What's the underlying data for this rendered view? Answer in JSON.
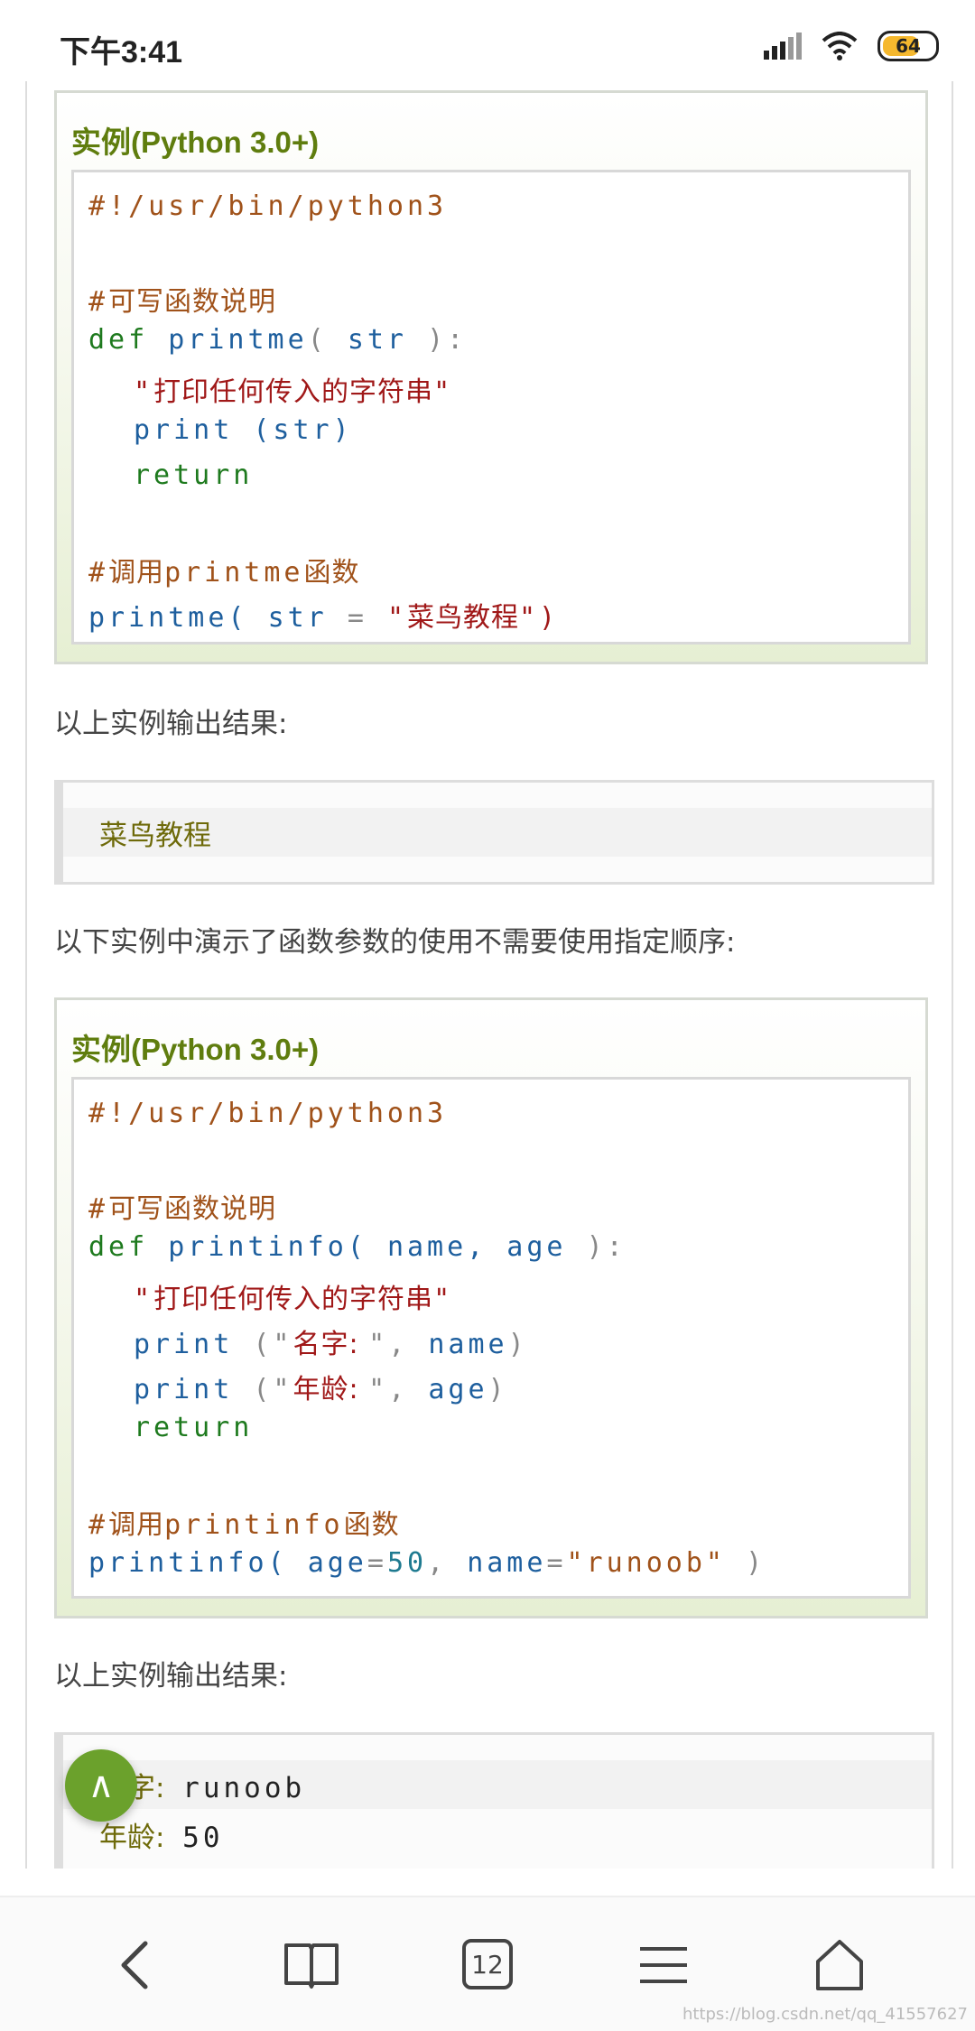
{
  "status": {
    "time": "下午3:41",
    "battery": "64"
  },
  "example1": {
    "title": "实例(Python 3.0+)",
    "lines": {
      "shebang": "#!/usr/bin/python3",
      "c_hash": "#",
      "c_text": "可写函数说明",
      "def_kw": "def",
      "fn": "printme",
      "open": "(",
      "param": "str",
      "close": "):",
      "doc_q1": "\"",
      "doc": "打印任何传入的字符串",
      "doc_q2": "\"",
      "print_kw": "print",
      "print_args": "(str)",
      "return_kw": "return",
      "call_hash": "#",
      "call_c1": "调用",
      "call_fn": "printme",
      "call_c2": "函数",
      "call_name": "printme(",
      "call_arg": "str",
      "call_eq": "=",
      "call_q1": "\"",
      "call_str": "菜鸟教程",
      "call_q2": "\")"
    }
  },
  "para1": "以上实例输出结果:",
  "output1": {
    "line1": "菜鸟教程"
  },
  "para2": "以下实例中演示了函数参数的使用不需要使用指定顺序:",
  "example2": {
    "title": "实例(Python 3.0+)",
    "lines": {
      "shebang": "#!/usr/bin/python3",
      "c_hash": "#",
      "c_text": "可写函数说明",
      "def_kw": "def",
      "fn": "printinfo(",
      "params": "name, age",
      "close": "):",
      "doc_q1": "\"",
      "doc": "打印任何传入的字符串",
      "doc_q2": "\"",
      "p1_kw": "print",
      "p1_open": "(\"",
      "p1_str": "名字: ",
      "p1_rest": "\",",
      "p1_var": "name",
      "p1_close": ")",
      "p2_kw": "print",
      "p2_open": "(\"",
      "p2_str": "年龄: ",
      "p2_rest": "\",",
      "p2_var": "age",
      "p2_close": ")",
      "return_kw": "return",
      "call_hash": "#",
      "call_c1": "调用",
      "call_fn": "printinfo",
      "call_c2": "函数",
      "call_name": "printinfo(",
      "call_a1": "age",
      "call_eq1": "=",
      "call_v1": "50",
      "call_comma": ",",
      "call_a2": "name",
      "call_eq2": "=",
      "call_v2": "\"runoob\"",
      "call_close": ")"
    }
  },
  "para3": "以上实例输出结果:",
  "output2": {
    "l1_label": "名字:",
    "l1_value": "runoob",
    "l2_label": "年龄:",
    "l2_value": "50"
  },
  "fab": {
    "label": "∧"
  },
  "nav": {
    "back": "back-icon",
    "bookmarks": "book-icon",
    "tabs_count": "12",
    "menu": "menu-icon",
    "home": "home-icon"
  },
  "watermark": "https://blog.csdn.net/qq_41557627"
}
